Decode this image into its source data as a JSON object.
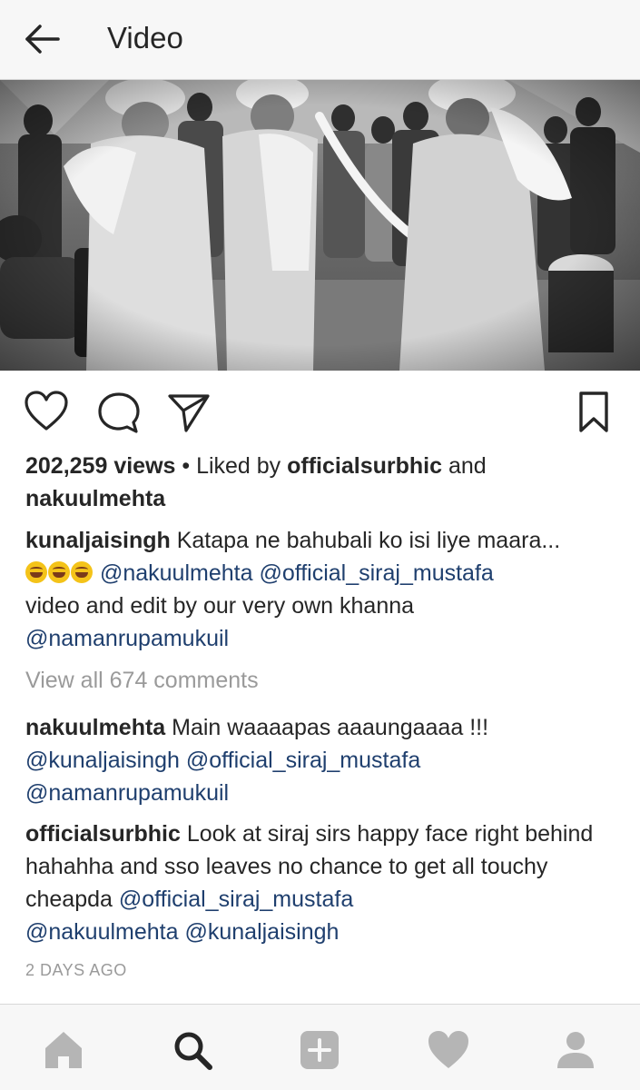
{
  "header": {
    "title": "Video"
  },
  "post": {
    "views": "202,259 views",
    "liked_by_prefix": " • Liked by ",
    "liked_by_user1": "officialsurbhic",
    "liked_by_and": " and",
    "liked_by_user2": "nakuulmehta",
    "caption": {
      "author": "kunaljaisingh",
      "text1": " Katapa ne bahubali ko isi liye maara...",
      "emojis": "😁😁😁",
      "mention1": "@nakuulmehta",
      "mention2": "@official_siraj_mustafa",
      "text2": "video and edit by our very own khanna",
      "mention3": "@namanrupamukuil"
    },
    "view_all_comments": "View all 674 comments",
    "comments": [
      {
        "author": "nakuulmehta",
        "text": " Main waaaapas aaaungaaaa !!!",
        "mention1": "@kunaljaisingh",
        "mention2": "@official_siraj_mustafa",
        "mention3": "@namanrupamukuil"
      },
      {
        "author": "officialsurbhic",
        "text": " Look at siraj sirs happy face right behind hahahha and sso leaves no chance to get all touchy cheapda ",
        "mention1": "@official_siraj_mustafa",
        "mention2": "@nakuulmehta",
        "mention3": "@kunaljaisingh"
      }
    ],
    "time_ago": "2 DAYS AGO"
  },
  "icons": {
    "back": "arrow-left-icon",
    "like": "heart-outline-icon",
    "comment": "comment-bubble-icon",
    "share": "paper-plane-icon",
    "save": "bookmark-icon",
    "home": "home-icon",
    "search": "search-icon",
    "add": "add-post-icon",
    "activity": "heart-icon",
    "profile": "profile-icon"
  },
  "colors": {
    "text": "#262626",
    "mention": "#1f3f6e",
    "muted": "#999999",
    "bar_bg": "#f7f7f7"
  }
}
